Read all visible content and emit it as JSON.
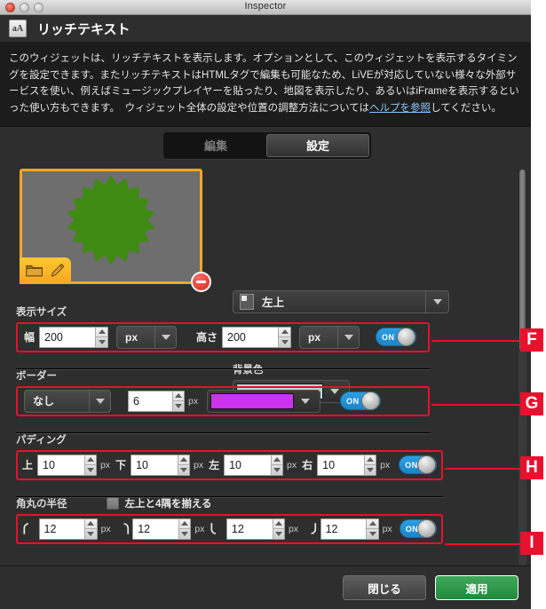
{
  "window": {
    "title": "Inspector",
    "traffic_lights": [
      "close",
      "minimize",
      "maximize"
    ]
  },
  "header": {
    "icon_text": "aA",
    "title": "リッチテキスト"
  },
  "description": {
    "text_part_1": "このウィジェットは、リッチテキストを表示します。オプションとして、このウィジェットを表示するタイミングを設定できます。またリッチテキストはHTMLタグで編集も可能なため、LiVEが対応していない様々な外部サービスを使い、例えばミュージックプレイヤーを貼ったり、地図を表示したり、あるいはiFrameを表示するといった使い方もできます。　ウィジェット全体の設定や位置の調整方法については",
    "link_text": "ヘルプを参照",
    "text_part_2": "してください。"
  },
  "tabs": [
    {
      "label": "編集",
      "selected": false
    },
    {
      "label": "設定",
      "selected": true
    }
  ],
  "preview": {
    "shape_color": "#3f8a12",
    "background": "#6e6e6e",
    "border_color": "#f5a623",
    "tools": [
      "folder-icon",
      "pencil-icon"
    ],
    "delete_label": "remove"
  },
  "align": {
    "label": "左上",
    "icon": "align-top-left-icon"
  },
  "background_color": {
    "label": "背景色",
    "value": "#b5d8d8"
  },
  "display_size": {
    "title": "表示サイズ",
    "width_label": "幅",
    "width_value": "200",
    "width_unit": "px",
    "height_label": "高さ",
    "height_value": "200",
    "height_unit": "px",
    "toggle": "ON"
  },
  "border": {
    "title": "ボーダー",
    "style_value": "なし",
    "width_value": "6",
    "width_unit": "px",
    "color_value": "#cc33ee",
    "toggle": "ON"
  },
  "padding": {
    "title": "パディング",
    "fields": [
      {
        "label": "上",
        "value": "10",
        "unit": "px"
      },
      {
        "label": "下",
        "value": "10",
        "unit": "px"
      },
      {
        "label": "左",
        "value": "10",
        "unit": "px"
      },
      {
        "label": "右",
        "value": "10",
        "unit": "px"
      }
    ],
    "toggle": "ON"
  },
  "corner_radius": {
    "title": "角丸の半径",
    "checkbox_label": "左上と4隅を揃える",
    "checkbox_checked": false,
    "fields": [
      {
        "icon": "corner-top-left-icon",
        "value": "12",
        "unit": "px"
      },
      {
        "icon": "corner-top-right-icon",
        "value": "12",
        "unit": "px"
      },
      {
        "icon": "corner-bottom-left-icon",
        "value": "12",
        "unit": "px"
      },
      {
        "icon": "corner-bottom-right-icon",
        "value": "12",
        "unit": "px"
      }
    ],
    "toggle": "ON"
  },
  "footer": {
    "close_label": "閉じる",
    "apply_label": "適用"
  },
  "annotations": [
    {
      "letter": "F",
      "target": "display-size-row"
    },
    {
      "letter": "G",
      "target": "border-row"
    },
    {
      "letter": "H",
      "target": "padding-row"
    },
    {
      "letter": "I",
      "target": "corner-radius-row"
    }
  ],
  "colors": {
    "accent_red": "#e8112d",
    "toggle_on": "#2f9ee0",
    "apply_green": "#2f9a48",
    "preview_border": "#f5a623"
  }
}
